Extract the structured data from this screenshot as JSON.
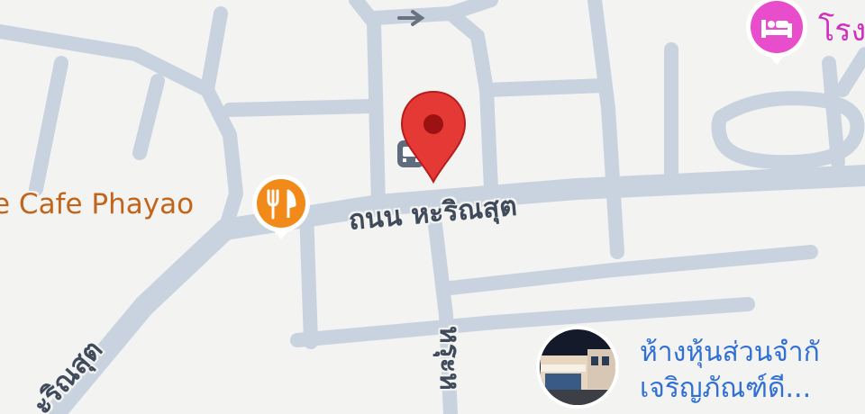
{
  "map": {
    "streets": [
      {
        "id": "main",
        "name": "ถนน หะริณสุต"
      },
      {
        "id": "diag",
        "name": "ะริณสุต"
      },
      {
        "id": "vert",
        "name": "หรุะห"
      }
    ],
    "pois": [
      {
        "id": "cafe",
        "name": "e Cafe Phayao",
        "icon": "restaurant-icon",
        "color": "#f28a1a"
      },
      {
        "id": "hotel",
        "name": "โรง",
        "icon": "bed-icon",
        "color": "#e84ecb"
      },
      {
        "id": "store",
        "name_line1": "ห้างหุ้นส่วนจำกั",
        "name_line2": "เจริญภัณฑ์ดี...",
        "icon": "photo-thumbnail"
      }
    ],
    "marker": {
      "icon": "location-pin-icon",
      "color": "#e53935"
    },
    "direction_arrow": {
      "icon": "one-way-arrow-icon"
    },
    "bus_stop": {
      "icon": "bus-icon"
    },
    "colors": {
      "background": "#f3f3f2",
      "road": "#c9d3df",
      "street_label": "#3f4a5a",
      "cafe_label": "#c2651b",
      "hotel_label": "#d22fc0",
      "store_label": "#2f6fd6"
    }
  }
}
